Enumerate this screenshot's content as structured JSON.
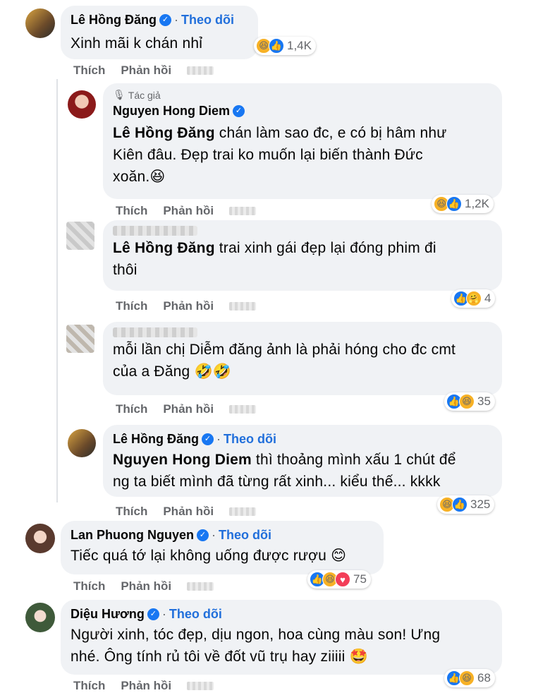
{
  "comments": [
    {
      "name": "Lê Hồng Đăng",
      "follow": "Theo dõi",
      "text": "Xinh mãi k chán nhỉ",
      "reaction_count": "1,4K",
      "like": "Thích",
      "reply": "Phản hồi"
    },
    {
      "author_tag": "Tác giả",
      "name": "Nguyen Hong Diem",
      "mention": "Lê Hồng Đăng",
      "text_line1_rest": " chán làm sao đc, e có bị hâm như",
      "text_line2": "Kiên đâu. Đẹp trai ko muốn lại biến thành Đức",
      "text_line3": "xoăn.",
      "reaction_count": "1,2K",
      "like": "Thích",
      "reply": "Phản hồi"
    },
    {
      "mention": "Lê Hồng Đăng",
      "text_line1_rest": " trai xinh gái đẹp lại đóng phim đi",
      "text_line2": "thôi",
      "reaction_count": "4",
      "like": "Thích",
      "reply": "Phản hồi"
    },
    {
      "text_line1": "mỗi lần chị Diễm đăng ảnh là phải hóng cho đc cmt",
      "text_line2": "của a Đăng",
      "reaction_count": "35",
      "like": "Thích",
      "reply": "Phản hồi"
    },
    {
      "name": "Lê Hồng Đăng",
      "follow": "Theo dõi",
      "mention": "Nguyen Hong Diem",
      "text_line1_rest": " thì thoảng mình xấu 1 chút để",
      "text_line2": "ng ta biết mình đã từng rất xinh... kiểu thế... kkkk",
      "reaction_count": "325",
      "like": "Thích",
      "reply": "Phản hồi"
    },
    {
      "name": "Lan Phuong Nguyen",
      "follow": "Theo dõi",
      "text": "Tiếc quá tớ lại không uống được rượu",
      "reaction_count": "75",
      "like": "Thích",
      "reply": "Phản hồi"
    },
    {
      "name": "Diệu Hương",
      "follow": "Theo dõi",
      "text_line1": "Người xinh, tóc đẹp, dịu ngon, hoa cùng màu son! Ưng",
      "text_line2": "nhé. Ông tính rủ tôi về đốt vũ trụ hay ziiiii",
      "reaction_count": "68",
      "like": "Thích",
      "reply": "Phản hồi"
    }
  ],
  "colors": {
    "bubble": "#f0f2f5",
    "link_blue": "#216fdb",
    "verified": "#1877f2",
    "secondary_text": "#65676b"
  },
  "icons": [
    "verified-badge-icon",
    "haha-reaction-icon",
    "like-reaction-icon",
    "care-reaction-icon",
    "author-mic-icon"
  ]
}
